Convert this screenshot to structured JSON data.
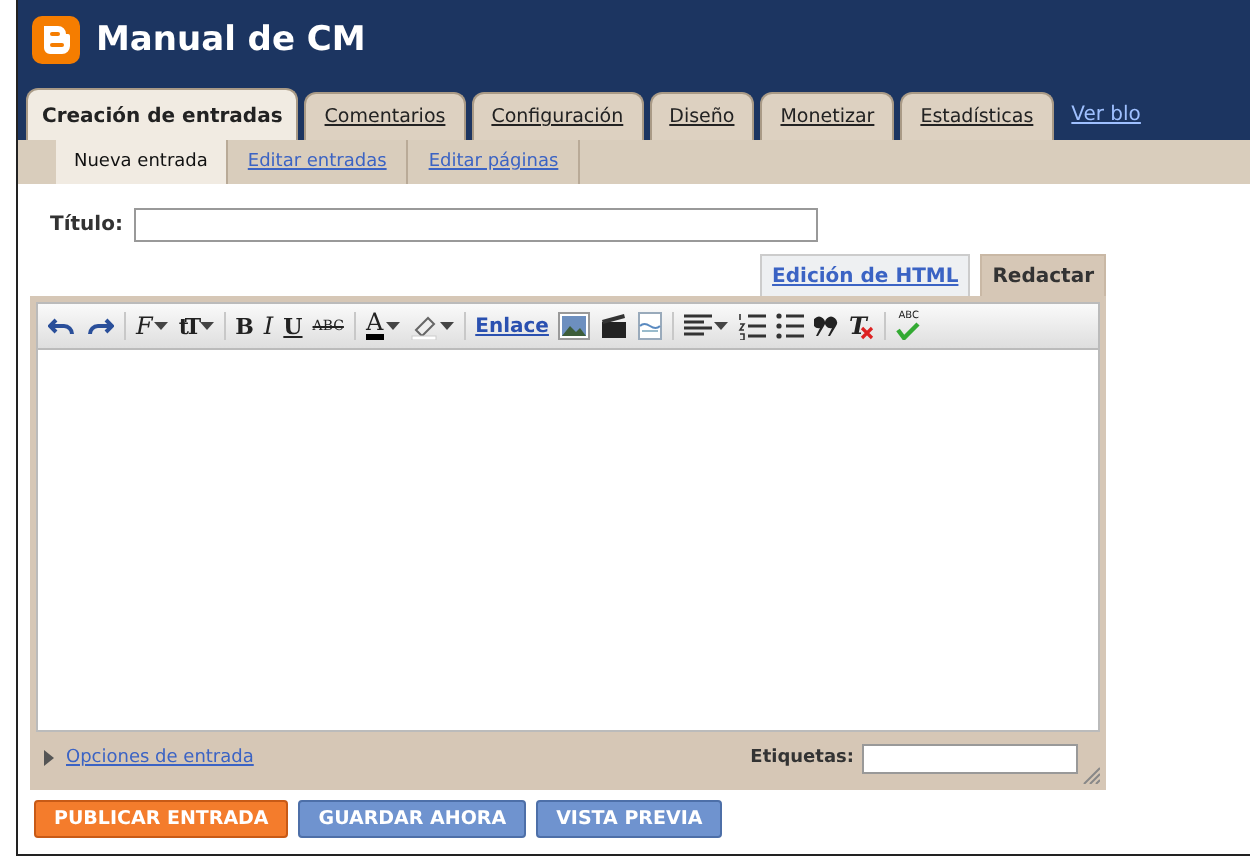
{
  "blog": {
    "title": "Manual de CM"
  },
  "tabs": [
    {
      "label": "Creación de entradas",
      "selected": true
    },
    {
      "label": "Comentarios",
      "selected": false
    },
    {
      "label": "Configuración",
      "selected": false
    },
    {
      "label": "Diseño",
      "selected": false
    },
    {
      "label": "Monetizar",
      "selected": false
    },
    {
      "label": "Estadísticas",
      "selected": false
    }
  ],
  "view_blog_link": "Ver blo",
  "subtabs": [
    {
      "label": "Nueva entrada",
      "selected": true
    },
    {
      "label": "Editar entradas",
      "selected": false
    },
    {
      "label": "Editar páginas",
      "selected": false
    }
  ],
  "post": {
    "title_label": "Título:"
  },
  "editor_modes": [
    {
      "label": "Edición de HTML",
      "selected": false
    },
    {
      "label": "Redactar",
      "selected": true
    }
  ],
  "toolbar": [
    {
      "kind": "undo"
    },
    {
      "kind": "redo"
    },
    {
      "kind": "separator"
    },
    {
      "kind": "font",
      "text": "F",
      "menu": true
    },
    {
      "kind": "size",
      "text": "tT",
      "menu": true
    },
    {
      "kind": "separator"
    },
    {
      "kind": "bold",
      "text": "B"
    },
    {
      "kind": "italic",
      "text": "I"
    },
    {
      "kind": "underline",
      "text": "U"
    },
    {
      "kind": "strike",
      "text": "ABC"
    },
    {
      "kind": "separator"
    },
    {
      "kind": "color",
      "text": "A",
      "menu": true
    },
    {
      "kind": "highlight",
      "menu": true
    },
    {
      "kind": "separator"
    },
    {
      "kind": "link",
      "text": "Enlace"
    },
    {
      "kind": "image"
    },
    {
      "kind": "video"
    },
    {
      "kind": "pagebreak"
    },
    {
      "kind": "separator"
    },
    {
      "kind": "align",
      "menu": true
    },
    {
      "kind": "olist"
    },
    {
      "kind": "ulist"
    },
    {
      "kind": "quote"
    },
    {
      "kind": "clear",
      "text": "T"
    },
    {
      "kind": "separator"
    },
    {
      "kind": "spell",
      "text": "ABC"
    }
  ],
  "options_link": "Opciones de entrada",
  "labels_label": "Etiquetas:",
  "buttons": [
    {
      "label": "PUBLICAR ENTRADA",
      "kind": "primary"
    },
    {
      "label": "GUARDAR AHORA",
      "kind": "secondary"
    },
    {
      "label": "VISTA PREVIA",
      "kind": "secondary"
    }
  ]
}
